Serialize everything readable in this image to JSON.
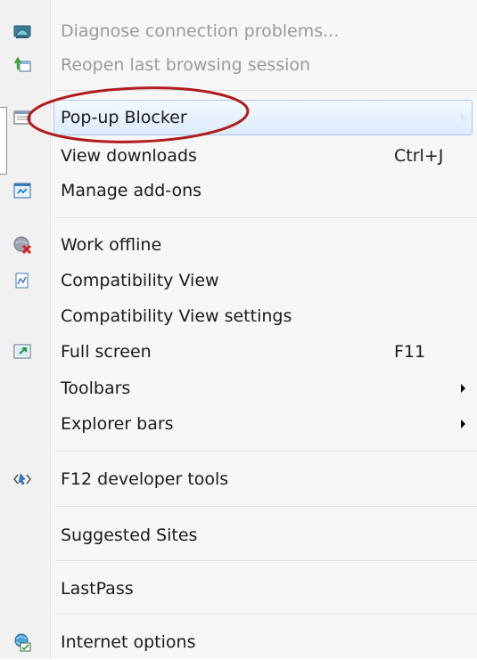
{
  "menu": {
    "items": [
      {
        "label": "Diagnose connection problems...",
        "icon": "diagnose-icon",
        "disabled": true
      },
      {
        "label": "Reopen last browsing session",
        "icon": "reopen-session-icon",
        "disabled": true
      },
      {
        "label": "Pop-up Blocker",
        "icon": "popup-blocker-icon",
        "submenu": true
      },
      {
        "label": "View downloads",
        "shortcut": "Ctrl+J"
      },
      {
        "label": "Manage add-ons",
        "icon": "addons-icon"
      },
      {
        "label": "Work offline",
        "icon": "work-offline-icon"
      },
      {
        "label": "Compatibility View",
        "icon": "compatibility-view-icon"
      },
      {
        "label": "Compatibility View settings"
      },
      {
        "label": "Full screen",
        "icon": "full-screen-icon",
        "shortcut": "F11"
      },
      {
        "label": "Toolbars",
        "submenu": true
      },
      {
        "label": "Explorer bars",
        "submenu": true
      },
      {
        "label": "F12 developer tools",
        "icon": "developer-tools-icon"
      },
      {
        "label": "Suggested Sites"
      },
      {
        "label": "LastPass"
      },
      {
        "label": "Internet options",
        "icon": "internet-options-icon"
      }
    ]
  },
  "colors": {
    "highlight_border": "#a8c8ee",
    "annotation_circle": "#b01c1c",
    "disabled_text": "#9a9a9a"
  }
}
